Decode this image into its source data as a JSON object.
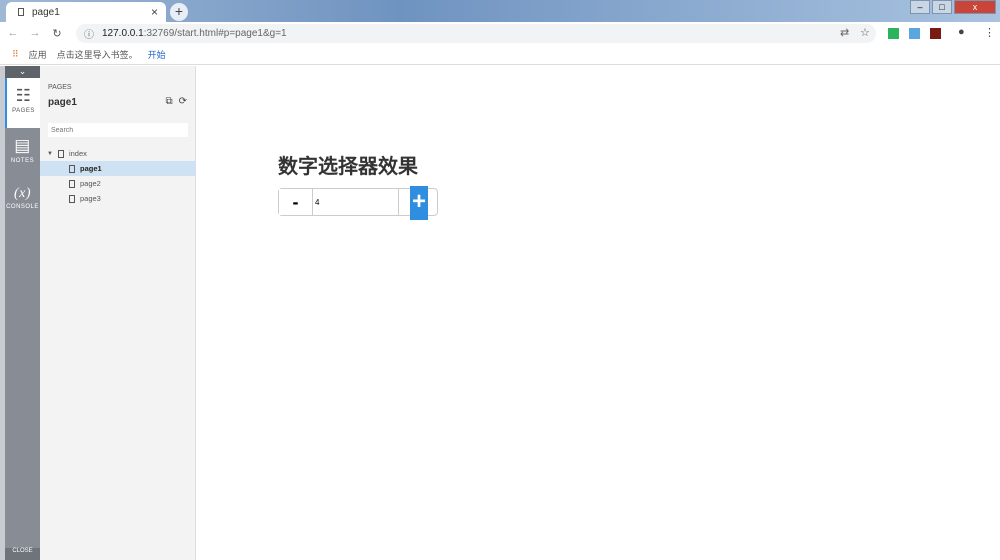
{
  "browser": {
    "tab_title": "page1",
    "tab_close": "×",
    "new_tab": "+",
    "url_host": "127.0.0.1",
    "url_rest": ":32769/start.html#p=page1&g=1",
    "window_buttons": [
      "–",
      "□",
      "x"
    ]
  },
  "bookmarks": {
    "apps": "应用",
    "import_text": "点击这里导入书签。",
    "start_link": "开始"
  },
  "rail": {
    "items": [
      {
        "label": "PAGES",
        "icon": "sitemap-icon"
      },
      {
        "label": "NOTES",
        "icon": "notes-icon"
      },
      {
        "label": "CONSOLE",
        "icon": "variable-icon",
        "glyph": "(x)"
      }
    ],
    "close": "CLOSE"
  },
  "panel": {
    "header": "PAGES",
    "current_page": "page1",
    "search_placeholder": "Search",
    "tree": {
      "root": "index",
      "children": [
        "page1",
        "page2",
        "page3"
      ],
      "selected": "page1"
    }
  },
  "main": {
    "title": "数字选择器效果",
    "minus": "-",
    "value": "4",
    "plus": "+"
  },
  "colors": {
    "accent": "#2f8ee0",
    "selected_row": "#cfe2f3"
  }
}
